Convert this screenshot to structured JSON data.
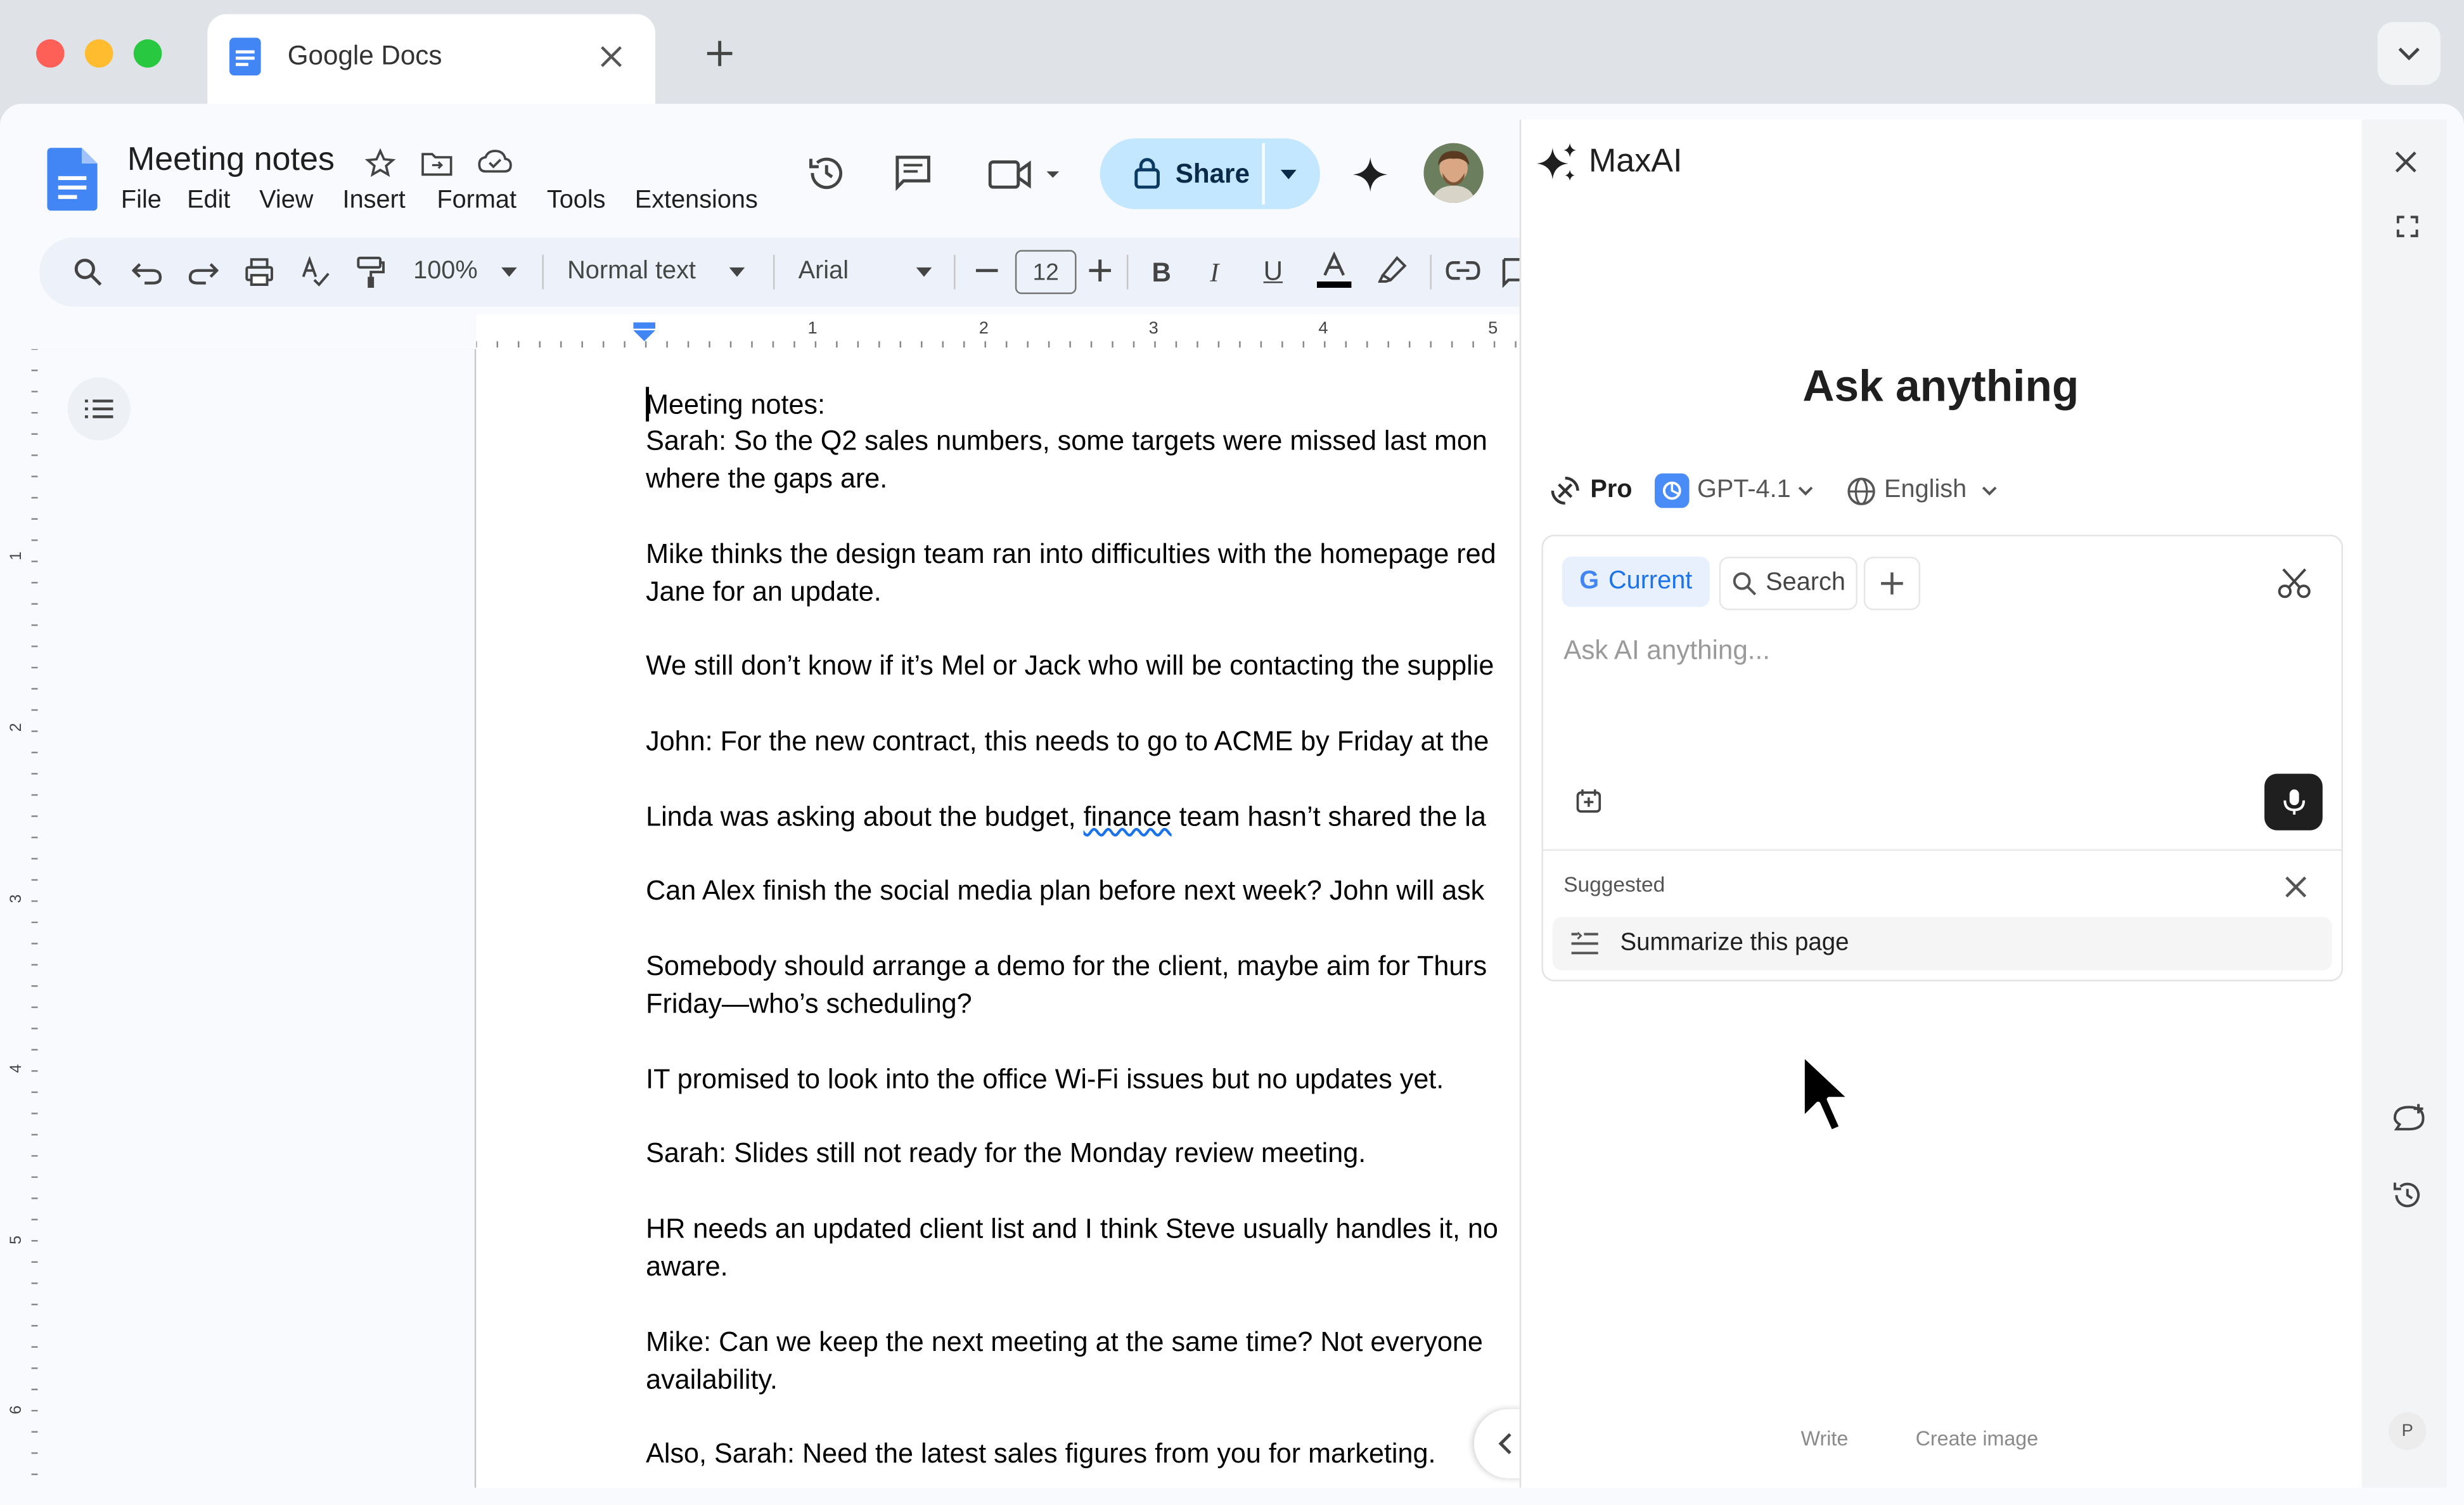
{
  "browser": {
    "tab_title": "Google Docs",
    "new_tab": "+"
  },
  "docs": {
    "title": "Meeting notes",
    "menu": [
      "File",
      "Edit",
      "View",
      "Insert",
      "Format",
      "Tools",
      "Extensions"
    ],
    "share_label": "Share",
    "toolbar": {
      "zoom": "100%",
      "style": "Normal text",
      "font": "Arial",
      "font_size": "12"
    },
    "ruler_numbers": [
      "1",
      "1",
      "2",
      "3",
      "4",
      "5"
    ],
    "vruler_numbers": [
      "1",
      "2",
      "3",
      "4",
      "5",
      "6"
    ],
    "content_lines": [
      "Meeting notes:",
      "Sarah: So the Q2 sales numbers, some targets were missed last mon",
      "where the gaps are.",
      "Mike thinks the design team ran into difficulties with the homepage red",
      "Jane for an update.",
      "We still don’t know if it’s Mel or Jack who will be contacting the supplie",
      "John: For the new contract, this needs to go to ACME by Friday at the",
      "Linda was asking about the budget, ",
      "finance",
      " team hasn’t shared the la",
      "Can Alex finish the social media plan before next week? John will ask",
      "Somebody should arrange a demo for the client, maybe aim for Thurs",
      "Friday—who’s scheduling?",
      "IT promised to look into the office Wi-Fi issues but no updates yet.",
      "Sarah: Slides still not ready for the Monday review meeting.",
      "HR needs an updated client list and I think Steve usually handles it, no",
      "aware.",
      "Mike: Can we keep the next meeting at the same time? Not everyone",
      "availability.",
      "Also, Sarah: Need the latest sales figures from you for marketing."
    ]
  },
  "maxai": {
    "brand": "MaxAI",
    "heading": "Ask anything",
    "plan": "Pro",
    "model": "GPT-4.1",
    "language": "English",
    "chips": {
      "current": "Current",
      "search": "Search"
    },
    "input_placeholder": "Ask AI anything...",
    "suggested_label": "Suggested",
    "suggestion": "Summarize this page",
    "footer": {
      "write": "Write",
      "create_image": "Create image"
    },
    "rail_avatar": "P"
  },
  "colors": {
    "accent_blue": "#1a73e8",
    "share_bg": "#c2e7ff",
    "chip_bg": "#e8f0fe"
  }
}
